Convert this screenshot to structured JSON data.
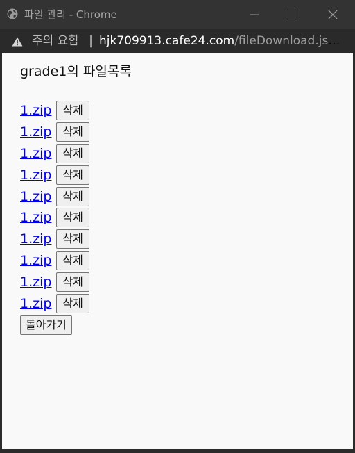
{
  "window": {
    "title": "파일 관리 - Chrome"
  },
  "addressbar": {
    "warning": "주의 요함",
    "separator": "|",
    "host": "hjk709913.cafe24.com",
    "path": "/fileDownload.jsp?it..."
  },
  "page": {
    "heading": "grade1의 파일목록",
    "files": [
      {
        "name": "1.zip",
        "delete_label": "삭제"
      },
      {
        "name": "1.zip",
        "delete_label": "삭제"
      },
      {
        "name": "1.zip",
        "delete_label": "삭제"
      },
      {
        "name": "1.zip",
        "delete_label": "삭제"
      },
      {
        "name": "1.zip",
        "delete_label": "삭제"
      },
      {
        "name": "1.zip",
        "delete_label": "삭제"
      },
      {
        "name": "1.zip",
        "delete_label": "삭제"
      },
      {
        "name": "1.zip",
        "delete_label": "삭제"
      },
      {
        "name": "1.zip",
        "delete_label": "삭제"
      },
      {
        "name": "1.zip",
        "delete_label": "삭제"
      }
    ],
    "back_label": "돌아가기"
  },
  "icons": {
    "globe": "globe-icon",
    "warning": "warning-icon",
    "minimize": "minimize-icon",
    "maximize": "maximize-icon",
    "close": "close-icon"
  },
  "colors": {
    "titlebar": "#333333",
    "content_bg": "#f9f9f9",
    "link": "#0000ee"
  }
}
